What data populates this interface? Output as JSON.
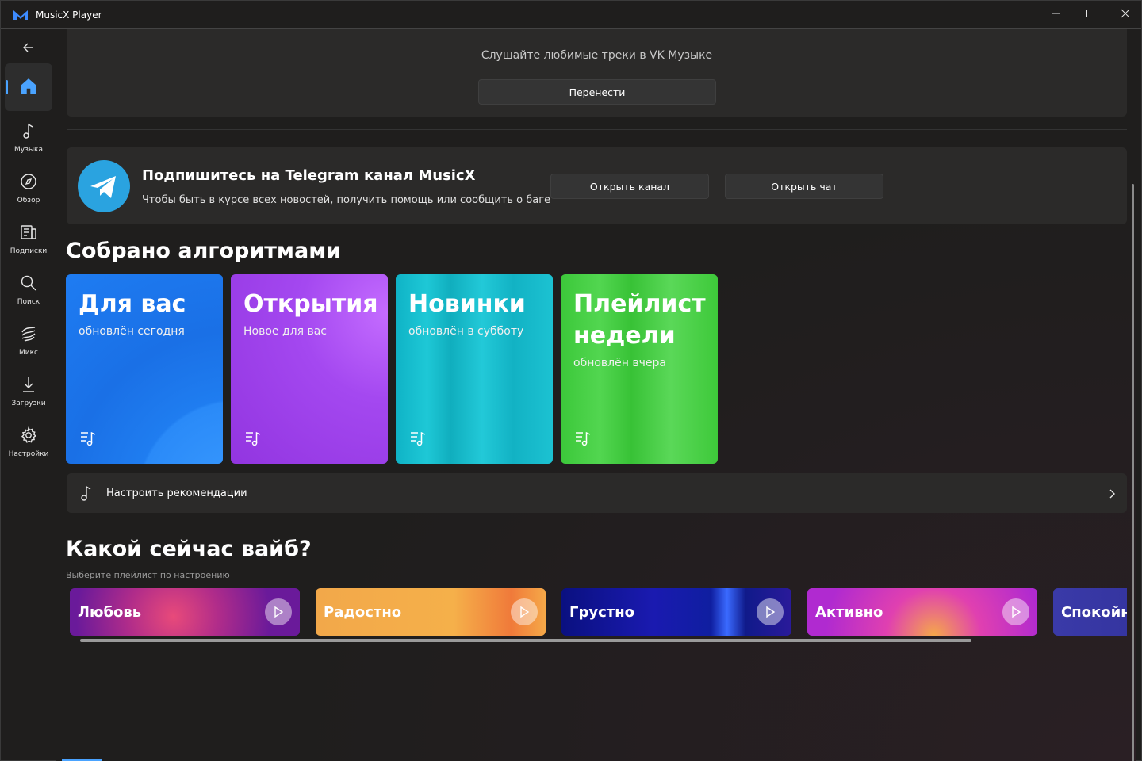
{
  "window": {
    "title": "MusicX Player"
  },
  "sidebar": {
    "items": [
      {
        "id": "home",
        "label": "",
        "icon": "home-icon",
        "active": true
      },
      {
        "id": "music",
        "label": "Музыка",
        "icon": "music-note-icon"
      },
      {
        "id": "overview",
        "label": "Обзор",
        "icon": "compass-icon"
      },
      {
        "id": "subscriptions",
        "label": "Подписки",
        "icon": "news-icon"
      },
      {
        "id": "search",
        "label": "Поиск",
        "icon": "search-icon"
      },
      {
        "id": "mix",
        "label": "Микс",
        "icon": "mix-icon"
      },
      {
        "id": "downloads",
        "label": "Загрузки",
        "icon": "download-icon"
      },
      {
        "id": "settings",
        "label": "Настройки",
        "icon": "gear-icon"
      }
    ]
  },
  "vk_transfer": {
    "subtitle": "Слушайте любимые треки в VK Музыке",
    "button": "Перенести"
  },
  "telegram": {
    "title": "Подпишитесь на Telegram канал MusicX",
    "description": "Чтобы быть в курсе всех новостей, получить помощь или сообщить о баге",
    "open_channel": "Открыть канал",
    "open_chat": "Открыть чат"
  },
  "algorithms": {
    "title": "Собрано алгоритмами",
    "cards": [
      {
        "title": "Для вас",
        "subtitle": "обновлён сегодня",
        "color": "#1f7df0"
      },
      {
        "title": "Открытия",
        "subtitle": "Новое для вас",
        "color": "#9b3ee8"
      },
      {
        "title": "Новинки",
        "subtitle": "обновлён в субботу",
        "color": "#12b5c8"
      },
      {
        "title": "Плейлист недели",
        "subtitle": "обновлён вчера",
        "color": "#3ec93a"
      }
    ],
    "configure": "Настроить рекомендации"
  },
  "vibe": {
    "title": "Какой сейчас вайб?",
    "subtitle": "Выберите плейлист по настроению",
    "moods": [
      {
        "label": "Любовь"
      },
      {
        "label": "Радостно"
      },
      {
        "label": "Грустно"
      },
      {
        "label": "Активно"
      },
      {
        "label": "Спокойно"
      }
    ]
  },
  "colors": {
    "accent": "#4aa3ff",
    "background": "#1f1e1d",
    "panel": "#2b2a29",
    "telegram": "#2aa3e0"
  }
}
